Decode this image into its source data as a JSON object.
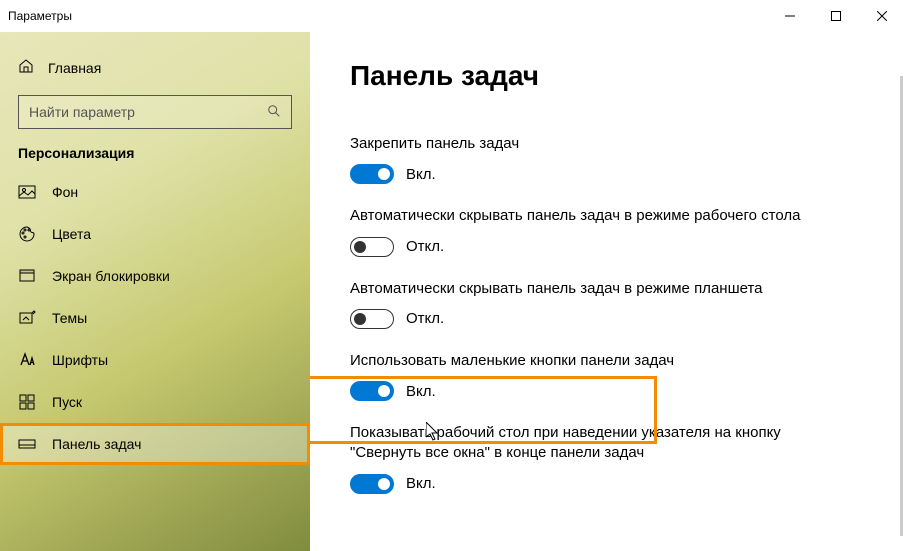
{
  "window": {
    "title": "Параметры"
  },
  "sidebar": {
    "home_label": "Главная",
    "search_placeholder": "Найти параметр",
    "section_header": "Персонализация",
    "items": [
      {
        "label": "Фон"
      },
      {
        "label": "Цвета"
      },
      {
        "label": "Экран блокировки"
      },
      {
        "label": "Темы"
      },
      {
        "label": "Шрифты"
      },
      {
        "label": "Пуск"
      },
      {
        "label": "Панель задач"
      }
    ]
  },
  "page": {
    "title": "Панель задач",
    "state_on": "Вкл.",
    "state_off": "Откл.",
    "settings": [
      {
        "label": "Закрепить панель задач",
        "on": true
      },
      {
        "label": "Автоматически скрывать панель задач в режиме рабочего стола",
        "on": false
      },
      {
        "label": "Автоматически скрывать панель задач в режиме планшета",
        "on": false
      },
      {
        "label": "Использовать маленькие кнопки панели задач",
        "on": true
      },
      {
        "label": "Показывать рабочий стол при наведении указателя на кнопку \"Свернуть все окна\" в конце панели задач",
        "on": true
      }
    ]
  }
}
